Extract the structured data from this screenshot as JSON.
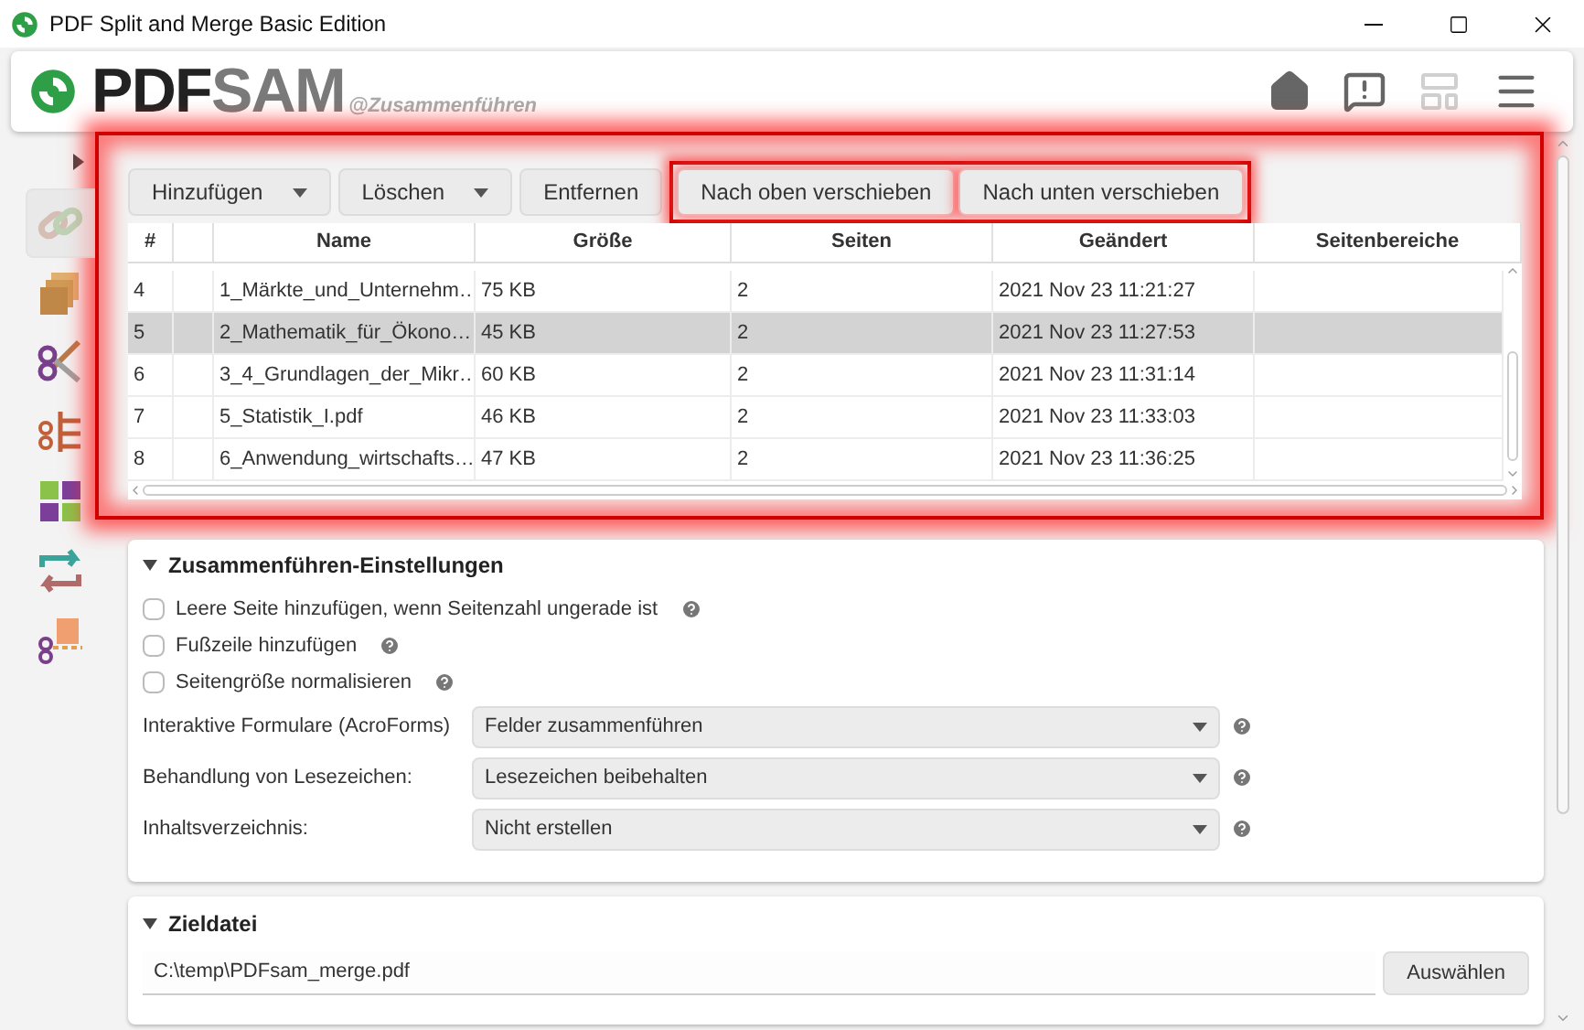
{
  "window": {
    "title": "PDF Split and Merge Basic Edition"
  },
  "header": {
    "logo_dark": "PDF",
    "logo_light": "SAM",
    "module": "@Zusammenführen",
    "icons": [
      {
        "kind": "home",
        "disabled": false
      },
      {
        "kind": "feedback",
        "disabled": false
      },
      {
        "kind": "layout",
        "disabled": true
      },
      {
        "kind": "menu",
        "disabled": false
      }
    ]
  },
  "sidebar": {
    "items": [
      {
        "kind": "merge",
        "selected": true
      },
      {
        "kind": "alternate",
        "selected": false
      },
      {
        "kind": "split",
        "selected": false
      },
      {
        "kind": "bookmarks",
        "selected": false
      },
      {
        "kind": "grid",
        "selected": false
      },
      {
        "kind": "rotate",
        "selected": false
      },
      {
        "kind": "extract",
        "selected": false
      }
    ]
  },
  "toolbar": {
    "buttons": [
      {
        "label": "Hinzufügen",
        "dropdown": true,
        "highlighted": false
      },
      {
        "label": "Löschen",
        "dropdown": true,
        "highlighted": false
      },
      {
        "label": "Entfernen",
        "dropdown": false,
        "highlighted": false
      },
      {
        "label": "Nach oben verschieben",
        "dropdown": false,
        "highlighted": true
      },
      {
        "label": "Nach unten verschieben",
        "dropdown": false,
        "highlighted": true
      }
    ]
  },
  "table": {
    "columns": [
      "#",
      "",
      "Name",
      "Größe",
      "Seiten",
      "Geändert",
      "Seitenbereiche"
    ],
    "rows": [
      {
        "index": "4",
        "name": "1_Märkte_und_Unternehm…",
        "size": "75 KB",
        "pages": "2",
        "modified": "2021 Nov 23 11:21:27",
        "selected": false
      },
      {
        "index": "5",
        "name": "2_Mathematik_für_Ökono…",
        "size": "45 KB",
        "pages": "2",
        "modified": "2021 Nov 23 11:27:53",
        "selected": true
      },
      {
        "index": "6",
        "name": "3_4_Grundlagen_der_Mikr…",
        "size": "60 KB",
        "pages": "2",
        "modified": "2021 Nov 23 11:31:14",
        "selected": false
      },
      {
        "index": "7",
        "name": "5_Statistik_I.pdf",
        "size": "46 KB",
        "pages": "2",
        "modified": "2021 Nov 23 11:33:03",
        "selected": false
      },
      {
        "index": "8",
        "name": "6_Anwendung_wirtschafts…",
        "size": "47 KB",
        "pages": "2",
        "modified": "2021 Nov 23 11:36:25",
        "selected": false
      }
    ]
  },
  "settings": {
    "title": "Zusammenführen-Einstellungen",
    "expanded": true,
    "checkboxes": [
      {
        "label": "Leere Seite hinzufügen, wenn Seitenzahl ungerade ist",
        "checked": false
      },
      {
        "label": "Fußzeile hinzufügen",
        "checked": false
      },
      {
        "label": "Seitengröße normalisieren",
        "checked": false
      }
    ],
    "selects": [
      {
        "label": "Interaktive Formulare (AcroForms)",
        "value": "Felder zusammenführen"
      },
      {
        "label": "Behandlung von Lesezeichen:",
        "value": "Lesezeichen beibehalten"
      },
      {
        "label": "Inhaltsverzeichnis:",
        "value": "Nicht erstellen"
      }
    ]
  },
  "destination": {
    "title": "Zieldatei",
    "expanded": true,
    "path": "C:\\temp\\PDFsam_merge.pdf",
    "button": "Auswählen"
  }
}
